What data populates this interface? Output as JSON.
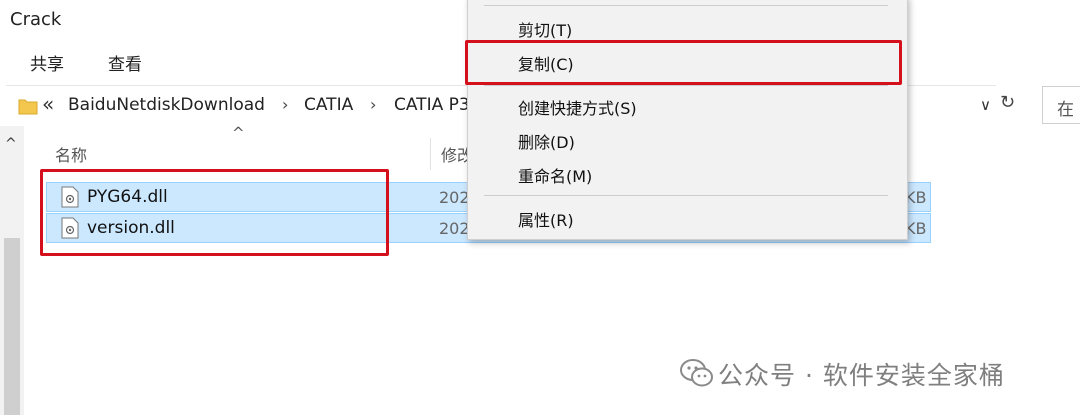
{
  "window": {
    "title": "Crack"
  },
  "ribbon": {
    "tabs": [
      "共享",
      "查看"
    ]
  },
  "address_bar": {
    "overflow": "«",
    "crumbs": [
      "BaiduNetdiskDownload",
      "CATIA",
      "CATIA P3"
    ],
    "arrow": "›",
    "dropdown": "∨",
    "refresh": "↻"
  },
  "search": {
    "placeholder": "在"
  },
  "nav": {
    "scroll_up": "^"
  },
  "columns": {
    "name": "名称",
    "modified": "修改",
    "sort": "^"
  },
  "files": [
    {
      "name": "PYG64.dll",
      "date": "202",
      "size": "KB"
    },
    {
      "name": "version.dll",
      "date": "202",
      "size": "KB"
    }
  ],
  "context_menu": {
    "items": [
      "剪切(T)",
      "复制(C)",
      "创建快捷方式(S)",
      "删除(D)",
      "重命名(M)",
      "属性(R)"
    ]
  },
  "watermark": {
    "text": "公众号 · 软件安装全家桶"
  },
  "colors": {
    "selection": "#cce8ff",
    "highlight": "#d3101c"
  },
  "icons": [
    "folder-icon",
    "refresh-icon",
    "dll-file-icon",
    "wechat-icon"
  ]
}
